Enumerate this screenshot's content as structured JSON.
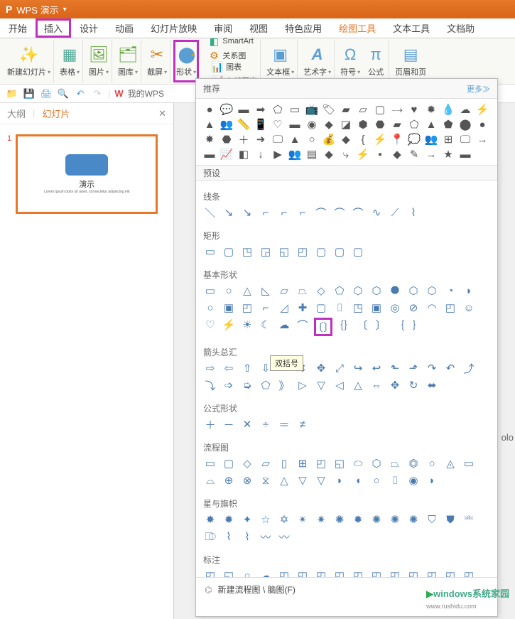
{
  "title_bar": {
    "app_icon": "P",
    "title": "WPS 演示",
    "caret": "▾"
  },
  "tabs": {
    "items": [
      "开始",
      "插入",
      "设计",
      "动画",
      "幻灯片放映",
      "审阅",
      "视图",
      "特色应用",
      "绘图工具",
      "文本工具",
      "文档助"
    ]
  },
  "ribbon": {
    "new_slide": "新建幻灯片",
    "table": "表格",
    "picture": "图片",
    "gallery": "图库",
    "screenshot": "截屏",
    "shapes": "形状",
    "smartart": "SmartArt",
    "chart": "图表",
    "relation": "关系图",
    "online_chart": "在线图表",
    "textbox": "文本框",
    "wordart": "艺术字",
    "symbol": "符号",
    "equation": "公式",
    "header_footer": "页眉和页"
  },
  "quick": {
    "mywps": "我的WPS"
  },
  "panel": {
    "tab_outline": "大纲",
    "tab_slides": "幻灯片",
    "close": "✕",
    "slide_num": "1",
    "slide_title": "演示",
    "slide_sub": "Lorem ipsum dolor sit amet, consectetur adipiscing elit"
  },
  "shapes_panel": {
    "header": "推荐",
    "more": "更多≫",
    "preset": "预设",
    "tooltip": "双括号",
    "footer_label": "新建流程图 \\ 脑图(F)",
    "categories": {
      "lines": "线条",
      "rects": "矩形",
      "basic": "基本形状",
      "arrows": "箭头总汇",
      "equation": "公式形状",
      "flowchart": "流程图",
      "stars": "星与旗帜",
      "callouts": "标注"
    }
  },
  "watermark": {
    "brand": "windows系统家园",
    "url": "www.rushidu.com"
  },
  "side_text": "olo"
}
